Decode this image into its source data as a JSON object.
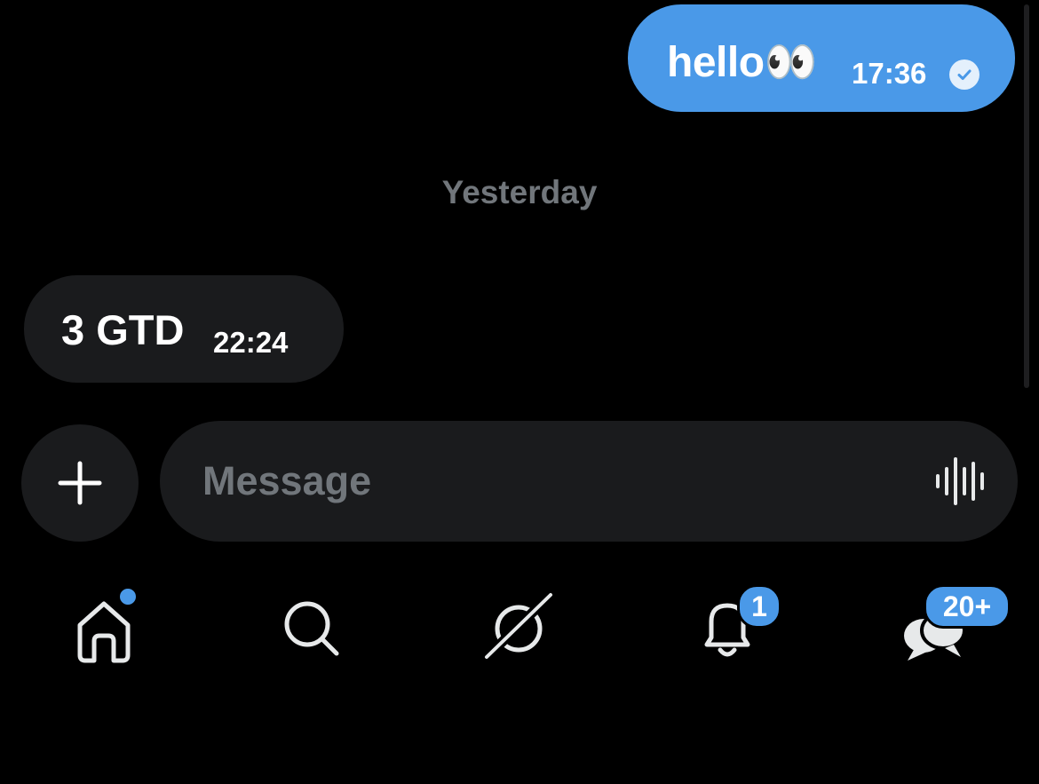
{
  "messages": {
    "outgoing": {
      "text": "hello👀",
      "time": "17:36",
      "status": "read"
    },
    "separator": "Yesterday",
    "incoming": {
      "text": "3 GTD",
      "time": "22:24"
    }
  },
  "composer": {
    "placeholder": "Message",
    "add_icon": "plus-icon",
    "voice_icon": "waveform-icon"
  },
  "nav": {
    "items": [
      {
        "id": "home",
        "icon": "home-icon",
        "has_dot": true
      },
      {
        "id": "search",
        "icon": "search-icon"
      },
      {
        "id": "grok",
        "icon": "grok-icon"
      },
      {
        "id": "notifications",
        "icon": "bell-icon",
        "badge": "1"
      },
      {
        "id": "messages",
        "icon": "chat-bubbles-icon",
        "badge": "20+"
      }
    ]
  },
  "colors": {
    "accent": "#4a99e8",
    "bubble_incoming": "#1a1b1d",
    "muted_text": "#71767b",
    "icon": "#e7e9ea"
  }
}
